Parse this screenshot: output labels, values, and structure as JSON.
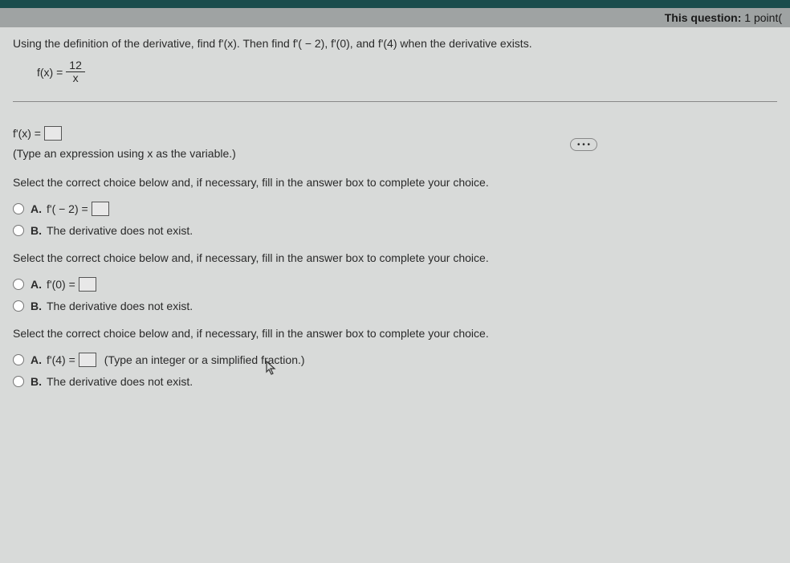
{
  "header": {
    "question_label": "This question:",
    "points": "1 point("
  },
  "question": {
    "text": "Using the definition of the derivative, find f'(x). Then find f'( − 2), f'(0), and f'(4) when the derivative exists.",
    "formula_lhs": "f(x) =",
    "formula_num": "12",
    "formula_den": "x"
  },
  "ellipsis": "• • •",
  "answer1": {
    "lhs": "f'(x) =",
    "hint": "(Type an expression using x as the variable.)"
  },
  "section_prompt": "Select the correct choice below and, if necessary, fill in the answer box to complete your choice.",
  "group1": {
    "a_label": "A.",
    "a_text": "f'( − 2) =",
    "b_label": "B.",
    "b_text": "The derivative does not exist."
  },
  "group2": {
    "a_label": "A.",
    "a_text": "f'(0) =",
    "b_label": "B.",
    "b_text": "The derivative does not exist."
  },
  "group3": {
    "a_label": "A.",
    "a_text": "f'(4) =",
    "a_hint": "(Type an integer or a simplified fraction.)",
    "b_label": "B.",
    "b_text": "The derivative does not exist."
  }
}
